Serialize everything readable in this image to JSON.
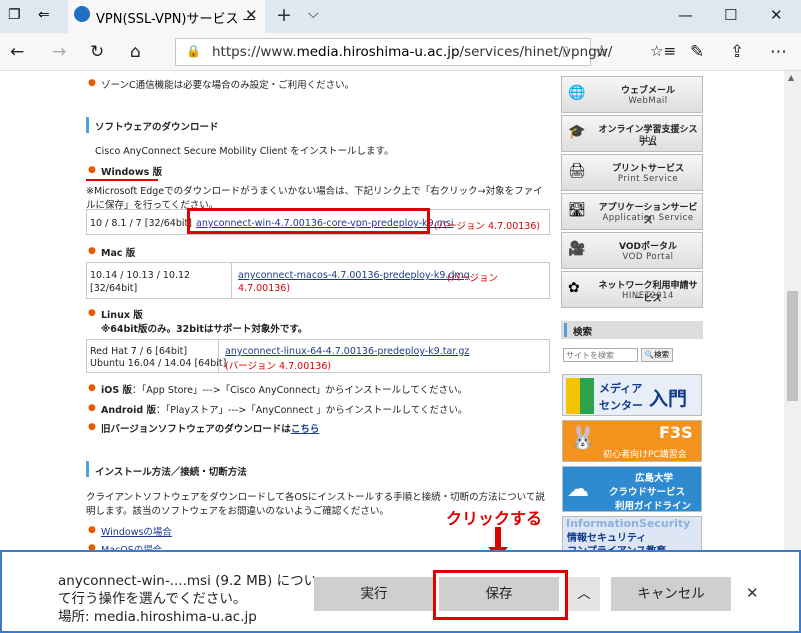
{
  "browser": {
    "tab_title": "VPN(SSL-VPN)サービス —",
    "url_prefix": "https://www.",
    "url_domain": "media.hiroshima-u.ac.jp",
    "url_path": "/services/hinet/vpngw/"
  },
  "content": {
    "zone_note": "ゾーンC通信機能は必要な場合のみ設定・ご利用ください。",
    "section_software": "ソフトウェアのダウンロード",
    "install_note": "Cisco AnyConnect Secure Mobility Client をインストールします。",
    "windows_heading": "Windows 版",
    "edge_note_1": "※Microsoft Edgeでのダウンロードがうまくいかない場合は、下記リンク上で「右クリック→対象をファイ",
    "edge_note_2": "ルに保存」を行ってください。",
    "win_os": "10 / 8.1 / 7 [32/64bit]",
    "win_link": "anyconnect-win-4.7.00136-core-vpn-predeploy-k9.msi",
    "win_version": "(バージョン 4.7.00136)",
    "mac_heading": "Mac 版",
    "mac_os_1": "10.14 / 10.13 / 10.12",
    "mac_os_2": "[32/64bit]",
    "mac_link": "anyconnect-macos-4.7.00136-predeploy-k9.dmg",
    "mac_version_1": "(バージョン",
    "mac_version_2": "4.7.00136)",
    "linux_heading": "Linux 版",
    "linux_note": "※64bit版のみ。32bitはサポート対象外です。",
    "linux_os_1": "Red Hat 7 / 6 [64bit]",
    "linux_os_2": "Ubuntu 16.04 / 14.04 [64bit]",
    "linux_link": "anyconnect-linux-64-4.7.00136-predeploy-k9.tar.gz",
    "linux_version": "(バージョン 4.7.00136)",
    "ios_label": "iOS 版",
    "ios_text": "：「App Store」--->「Cisco AnyConnect」からインストールしてください。",
    "android_label": "Android 版",
    "android_text": "：「Playストア」--->「AnyConnect 」からインストールしてください。",
    "old_text": "旧バージョンソフトウェアのダウンロードは",
    "old_link": "こちら",
    "section_install": "インストール方法／接続・切断方法",
    "install_desc_1": "クライアントソフトウェアをダウンロードして各OSにインストールする手順と接続・切断の方法について説",
    "install_desc_2": "明します。該当のソフトウェアをお間違いのないようご確認ください。",
    "win_case": "Windowsの場合",
    "mac_case": "MacOSの場合"
  },
  "sidebar": {
    "items": [
      {
        "title": "ウェブメール",
        "sub": "WebMail",
        "icon": "🌐"
      },
      {
        "title": "オンライン学習支援システム",
        "sub": "Bb9",
        "icon": "🎓"
      },
      {
        "title": "プリントサービス",
        "sub": "Print Service",
        "icon": "🖨"
      },
      {
        "title": "アプリケーションサービス",
        "sub": "Application Service",
        "icon": "🛣"
      },
      {
        "title": "VODポータル",
        "sub": "VOD Portal",
        "icon": "🎥"
      },
      {
        "title": "ネットワーク利用申請サービス",
        "sub": "HINET2014",
        "icon": "✿"
      }
    ],
    "search_title": "検索",
    "search_placeholder": "サイトを検索",
    "search_button": "検索",
    "banner_media_1": "メディア",
    "banner_media_2": "センター",
    "banner_media_3": "入門",
    "banner_f3s": "F3S",
    "banner_f3s_sub": "初心者向けPC講習会",
    "banner_cloud_1": "広島大学",
    "banner_cloud_2": "クラウドサービス",
    "banner_cloud_3": "利用ガイドライン",
    "banner_sec_en": "InformationSecurity",
    "banner_sec_1": "情報セキュリティ",
    "banner_sec_2": "コンプライアンス教育"
  },
  "annotation": {
    "click_label": "クリックする"
  },
  "download": {
    "message_1": "anyconnect-win-....msi (9.2 MB) につい",
    "message_2": "て行う操作を選んでください。",
    "location": "場所: media.hiroshima-u.ac.jp",
    "run": "実行",
    "save": "保存",
    "cancel": "キャンセル"
  }
}
